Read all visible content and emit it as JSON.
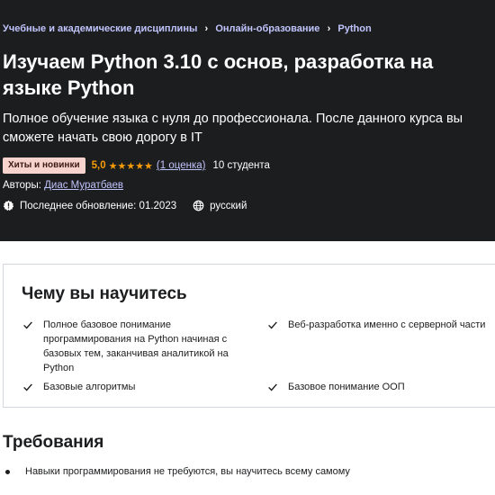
{
  "breadcrumb": [
    "Учебные и академические дисциплины",
    "Онлайн-образование",
    "Python"
  ],
  "course": {
    "title": "Изучаем Python 3.10 с основ, разработка на языке Python",
    "subtitle": "Полное обучение языка с нуля до профессионала. После данного курса вы сможете начать свою дорогу в IT",
    "badge": "Хиты и новинки",
    "rating": "5,0",
    "stars": "★★★★★",
    "ratings_count": "(1 оценка)",
    "students": "10 студента",
    "authors_label": "Авторы:",
    "author": "Диас Муратбаев",
    "last_updated": "Последнее обновление: 01.2023",
    "language": "русский"
  },
  "learn": {
    "title": "Чему вы научитесь",
    "items": [
      "Полное базовое понимание программирования на Python начиная с базовых тем, заканчивая аналитикой на Python",
      "Веб-разработка именно с серверной части",
      "Базовые алгоритмы",
      "Базовое понимание ООП"
    ]
  },
  "requirements": {
    "title": "Требования",
    "items": [
      "Навыки программирования не требуются, вы научитесь всему самому"
    ]
  },
  "colors": {
    "hero_bg": "#1c1d1f",
    "link": "#c0c4fc",
    "rating": "#f69c08",
    "badge_bg": "#f6d3cc"
  }
}
